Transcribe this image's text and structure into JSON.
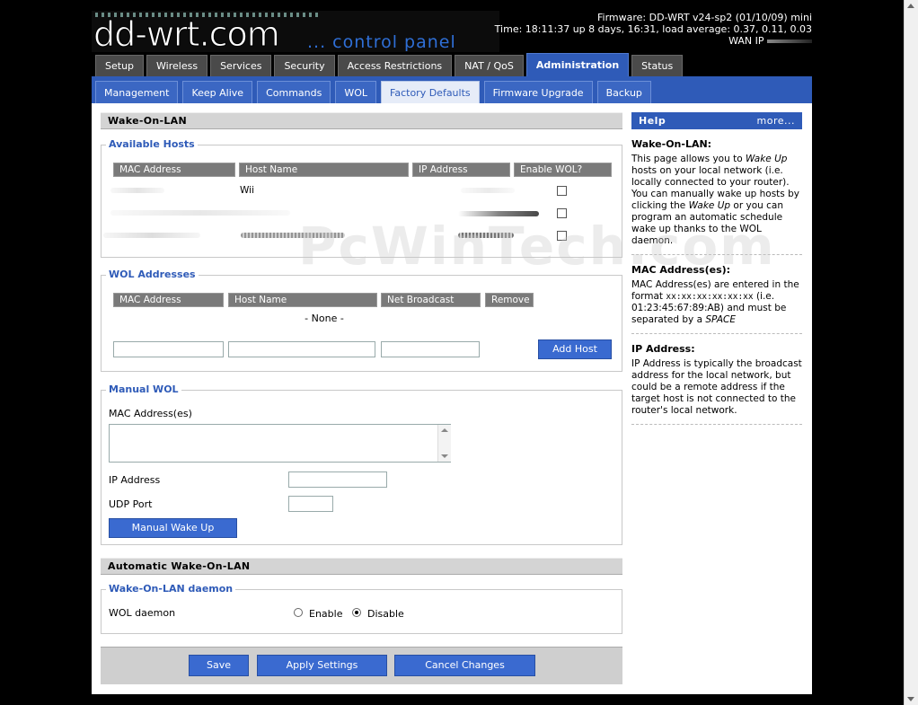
{
  "header": {
    "logo_text": "dd-wrt",
    "logo_com": ".com",
    "logo_tagline": "... control panel",
    "firmware": "Firmware: DD-WRT v24-sp2 (01/10/09) mini",
    "time": "Time: 18:11:37 up 8 days, 16:31, load average: 0.37, 0.11, 0.03",
    "wan_ip": "WAN IP"
  },
  "main_tabs": [
    "Setup",
    "Wireless",
    "Services",
    "Security",
    "Access Restrictions",
    "NAT / QoS",
    "Administration",
    "Status"
  ],
  "sub_tabs": [
    "Management",
    "Keep Alive",
    "Commands",
    "WOL",
    "Factory Defaults",
    "Firmware Upgrade",
    "Backup"
  ],
  "wol": {
    "title": "Wake-On-LAN",
    "available_hosts": {
      "legend": "Available Hosts",
      "columns": [
        "MAC Address",
        "Host Name",
        "IP Address",
        "Enable WOL?"
      ],
      "rows": [
        {
          "host": "Wii"
        },
        {
          "host": ""
        },
        {
          "host": ""
        }
      ]
    },
    "wol_addresses": {
      "legend": "WOL Addresses",
      "columns": [
        "MAC Address",
        "Host Name",
        "Net Broadcast",
        "Remove"
      ],
      "empty": "- None -",
      "add_button": "Add Host"
    },
    "manual": {
      "legend": "Manual WOL",
      "mac_label": "MAC Address(es)",
      "ip_label": "IP Address",
      "udp_label": "UDP Port",
      "button": "Manual Wake Up"
    }
  },
  "auto": {
    "title": "Automatic Wake-On-LAN",
    "legend": "Wake-On-LAN daemon",
    "daemon_label": "WOL daemon",
    "enable": "Enable",
    "disable": "Disable"
  },
  "buttons": {
    "save": "Save",
    "apply": "Apply Settings",
    "cancel": "Cancel Changes"
  },
  "help": {
    "title": "Help",
    "more": "more...",
    "sections": [
      {
        "title": "Wake-On-LAN:",
        "p1": "This page allows you to ",
        "em1": "Wake Up",
        "p2": " hosts on your local network (i.e. locally connected to your router). You can manually wake up hosts by clicking the ",
        "em2": "Wake Up",
        "p3": " or you can program an automatic schedule wake up thanks to the WOL daemon."
      },
      {
        "title": "MAC Address(es):",
        "p1": "MAC Address(es) are entered in the format ",
        "mono": "xx:xx:xx:xx:xx:xx",
        "p2": " (i.e. 01:23:45:67:89:AB) and must be separated by a ",
        "em": "SPACE"
      },
      {
        "title": "IP Address:",
        "p1": "IP Address is typically the broadcast address for the local network, but could be a remote address if the target host is not connected to the router's local network."
      }
    ]
  },
  "watermark": "PcWinTech.com"
}
